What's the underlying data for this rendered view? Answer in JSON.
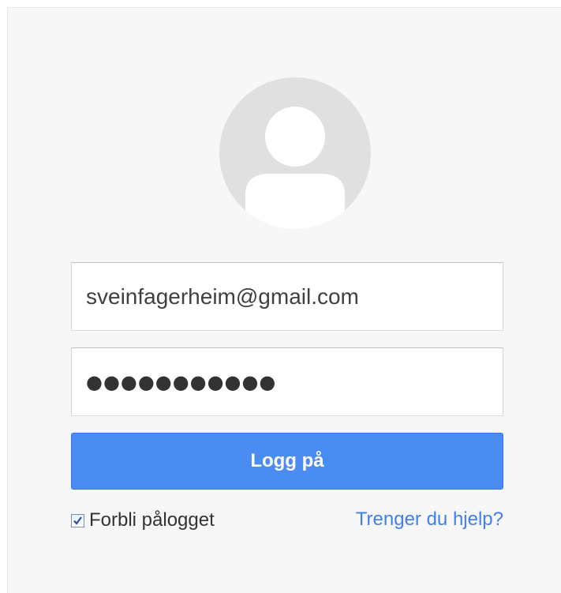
{
  "signin": {
    "email_value": "sveinfagerheim@gmail.com",
    "password_value": "●●●●●●●●●●●",
    "login_button_label": "Logg på",
    "stay_signed_in_label": "Forbli pålogget",
    "stay_signed_in_checked": true,
    "help_link_label": "Trenger du hjelp?"
  },
  "icons": {
    "avatar": "default-user-avatar-icon",
    "checkbox": "checkmark-icon"
  },
  "colors": {
    "background_card": "#f7f7f7",
    "avatar_circle": "#e0e0e0",
    "button_blue": "#4a8cf1",
    "link_blue": "#427fed",
    "text_dark": "#404040"
  }
}
